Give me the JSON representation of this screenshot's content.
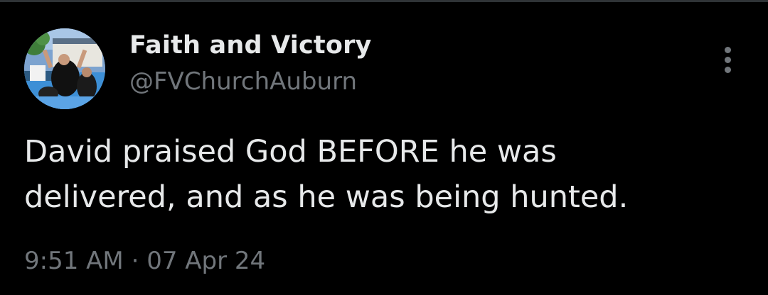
{
  "author": {
    "display_name": "Faith and Victory",
    "handle": "@FVChurchAuburn"
  },
  "tweet": {
    "text_lines": [
      "David praised God BEFORE he was",
      "delivered, and as he was being hunted."
    ],
    "time": "9:51 AM",
    "separator": "·",
    "date": "07 Apr 24"
  },
  "icons": {
    "more": "more-options-icon"
  },
  "colors": {
    "background": "#000000",
    "primary_text": "#e7e9ea",
    "secondary_text": "#71767b",
    "border": "#2f3336"
  }
}
